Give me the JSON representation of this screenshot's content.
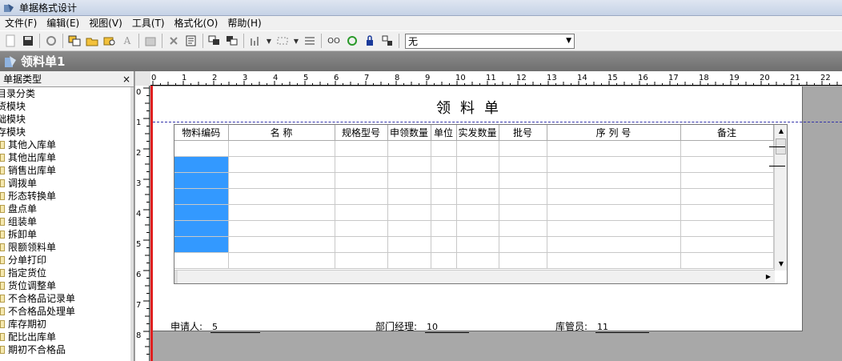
{
  "window": {
    "title": "单据格式设计"
  },
  "menu": [
    "文件(F)",
    "编辑(E)",
    "视图(V)",
    "工具(T)",
    "格式化(O)",
    "帮助(H)"
  ],
  "toolbar": {
    "dropdown_value": "无",
    "oo_label": "OO",
    "font_label": "A"
  },
  "document": {
    "tab_title": "领料单1"
  },
  "left_panel": {
    "title": "单据类型",
    "close": "×",
    "root_items": [
      "目录分类",
      "货模块",
      "础模块",
      "存模块"
    ],
    "items": [
      "其他入库单",
      "其他出库单",
      "销售出库单",
      "调拨单",
      "形态转换单",
      "盘点单",
      "组装单",
      "拆卸单",
      "限额领料单",
      "分单打印",
      "指定货位",
      "货位调整单",
      "不合格品记录单",
      "不合格品处理单",
      "库存期初",
      "配比出库单",
      "期初不合格品"
    ]
  },
  "ruler": {
    "h_labels": [
      "0",
      "1",
      "2",
      "3",
      "4",
      "5",
      "6",
      "7",
      "8",
      "9",
      "10",
      "11",
      "12",
      "13",
      "14",
      "15",
      "16",
      "17",
      "18",
      "19",
      "20",
      "21",
      "22"
    ],
    "v_labels": [
      "0",
      "1",
      "2",
      "3",
      "4",
      "5",
      "6",
      "7",
      "8"
    ]
  },
  "form": {
    "title": "领料单",
    "columns": [
      "物料编码",
      "名  称",
      "规格型号",
      "申领数量",
      "单位",
      "实发数量",
      "批号",
      "序 列 号",
      "备注"
    ],
    "footer": [
      {
        "label": "申请人:",
        "value": "5"
      },
      {
        "label": "部门经理:",
        "value": "10"
      },
      {
        "label": "库管员:",
        "value": "11"
      }
    ]
  }
}
